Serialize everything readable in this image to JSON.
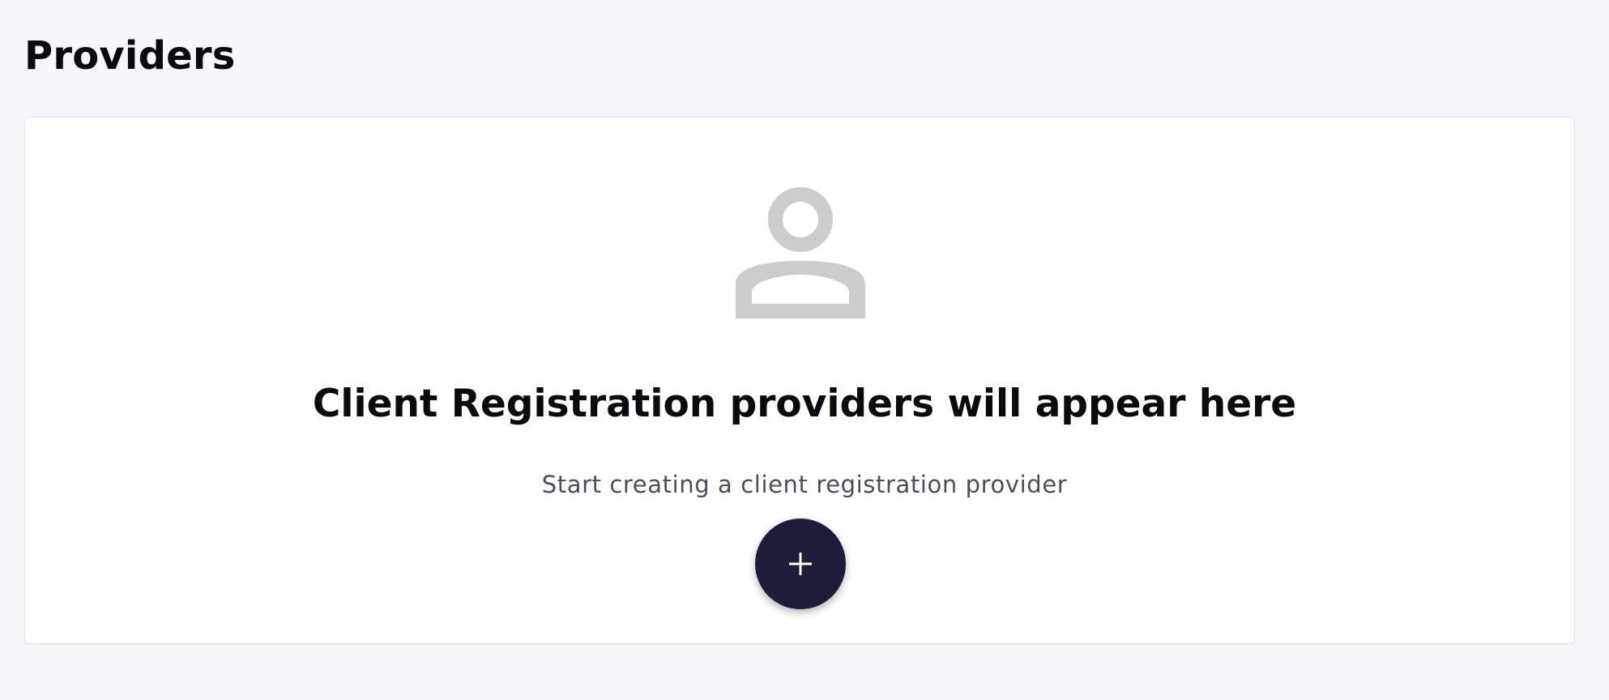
{
  "page": {
    "title": "Providers"
  },
  "empty_state": {
    "icon": "person-icon",
    "title": "Client Registration providers will appear here",
    "subtitle": "Start creating a client registration provider",
    "add_button_icon": "plus-icon"
  },
  "colors": {
    "background": "#f6f7fb",
    "card_background": "#ffffff",
    "icon_gray": "#cccccc",
    "add_button": "#1d1c3b",
    "title_text": "#0b0b0f",
    "subtitle_text": "#4a4f5a"
  }
}
